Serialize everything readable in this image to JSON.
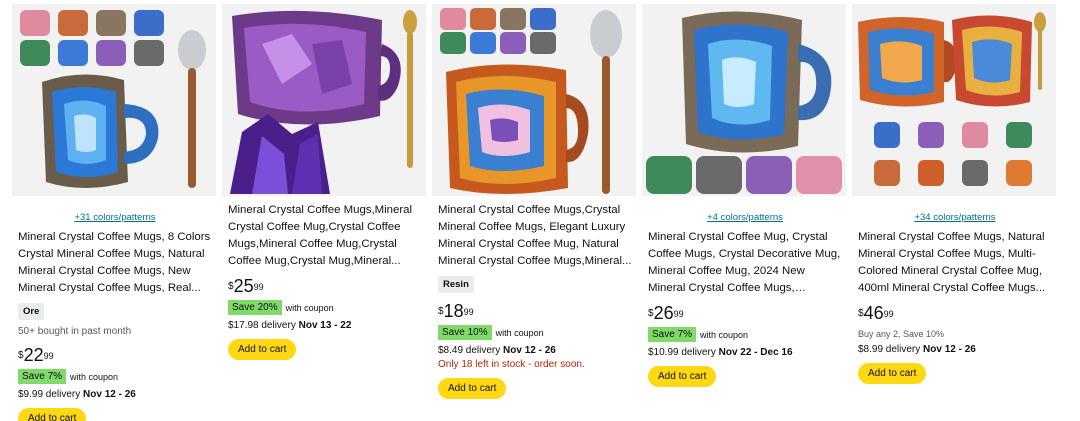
{
  "products": [
    {
      "colors": "+31 colors/patterns",
      "title": "Mineral Crystal Coffee Mugs, 8 Colors Crystal Mineral Coffee Mugs, Natural Mineral Crystal Coffee Mugs, New Mineral Crystal Coffee Mugs, Real...",
      "variant": "Ore",
      "bought": "50+ bought in past month",
      "price": {
        "symbol": "$",
        "whole": "22",
        "fraction": "99"
      },
      "coupon": {
        "save": "Save 7%",
        "text": "with coupon"
      },
      "delivery": {
        "fee": "$9.99 delivery",
        "dates": "Nov 12 - 26"
      },
      "cart": "Add to cart"
    },
    {
      "title": "Mineral Crystal Coffee Mugs,Mineral Crystal Coffee Mug,Crystal Coffee Mugs,Mineral Coffee Mug,Crystal Coffee Mug,Crystal Mug,Mineral...",
      "price": {
        "symbol": "$",
        "whole": "25",
        "fraction": "99"
      },
      "coupon": {
        "save": "Save 20%",
        "text": "with coupon"
      },
      "delivery": {
        "fee": "$17.98 delivery",
        "dates": "Nov 13 - 22"
      },
      "cart": "Add to cart"
    },
    {
      "title": "Mineral Crystal Coffee Mugs,Crystal Mineral Coffee Mugs, Elegant Luxury Mineral Crystal Coffee Mug, Natural Mineral Crystal Coffee Mugs,Mineral...",
      "variant": "Resin",
      "price": {
        "symbol": "$",
        "whole": "18",
        "fraction": "99"
      },
      "coupon": {
        "save": "Save 10%",
        "text": "with coupon"
      },
      "delivery": {
        "fee": "$8.49 delivery",
        "dates": "Nov 12 - 26"
      },
      "stock": "Only 18 left in stock - order soon.",
      "cart": "Add to cart"
    },
    {
      "colors": "+4 colors/patterns",
      "title": "Mineral Crystal Coffee Mug, Crystal Coffee Mugs, Crystal Decorative Mug, Mineral Coffee Mug, 2024 New Mineral Crystal Coffee Mugs, Minera...",
      "price": {
        "symbol": "$",
        "whole": "26",
        "fraction": "99"
      },
      "coupon": {
        "save": "Save 7%",
        "text": "with coupon"
      },
      "delivery": {
        "fee": "$10.99 delivery",
        "dates": "Nov 22 - Dec 16"
      },
      "cart": "Add to cart"
    },
    {
      "colors": "+34 colors/patterns",
      "title": "Mineral Crystal Coffee Mugs, Natural Mineral Crystal Coffee Mugs, Multi-Colored Mineral Crystal Coffee Mug, 400ml Mineral Crystal Coffee Mugs...",
      "price": {
        "symbol": "$",
        "whole": "46",
        "fraction": "99"
      },
      "promo": "Buy any 2, Save 10%",
      "delivery": {
        "fee": "$8.99 delivery",
        "dates": "Nov 12 - 26"
      },
      "cart": "Add to cart"
    }
  ],
  "colors": {
    "link": "#007185",
    "save_badge": "#7fda69",
    "cart_button": "#ffd814",
    "stock_warning": "#b12704",
    "image_bg": "#f2f2f2"
  }
}
